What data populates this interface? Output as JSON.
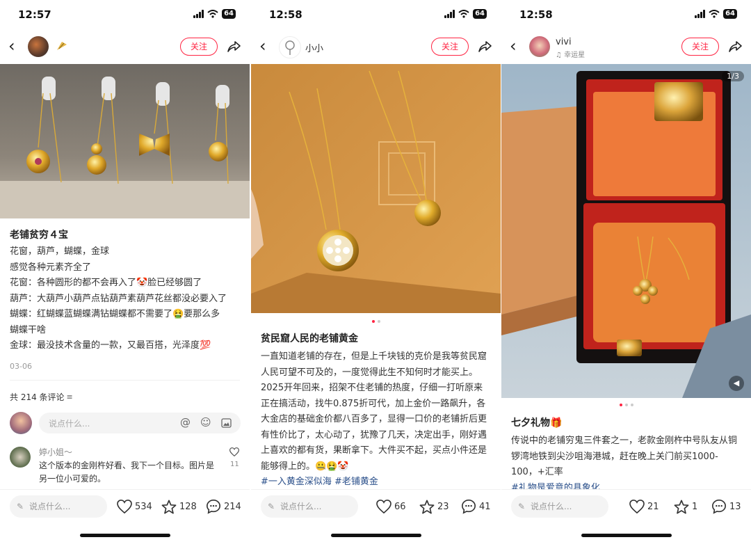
{
  "panels": [
    {
      "time": "12:57",
      "battery": "64",
      "follow": "关注",
      "title": "老铺贫穷４宝",
      "lines": [
        "花窗，葫芦，蝴蝶，金球",
        "感觉各种元素齐全了",
        "花窗：各种圆形的都不会再入了🤡脸已经够圆了",
        "葫芦：大葫芦小葫芦点钻葫芦素葫芦花丝都没必要入了",
        "蝴蝶：红蝴蝶蓝蝴蝶满钻蝴蝶都不需要了🤮要那么多",
        "蝴蝶干啥",
        "金球：最没技术含量的一款，又最百搭，光泽度💯"
      ],
      "date": "03-06",
      "comments_count": "共 214 条评论",
      "comment_placeholder": "说点什么...",
      "comment_user": "婷小姐～",
      "comment_text": "这个版本的金刚杵好看、我下一个目标。图片是另一位小可爱的。",
      "comment_likes": "11",
      "bar_placeholder": "说点什么...",
      "likes": "534",
      "stars": "128",
      "comments": "214"
    },
    {
      "time": "12:58",
      "battery": "64",
      "username": "小小",
      "follow": "关注",
      "title": "贫民窟人民的老铺黄金",
      "body": "一直知道老铺的存在，但是上千块钱的克价是我等贫民窟人民可望不可及的，一度觉得此生不知何时才能买上。2025开年回来，招架不住老铺的热度，仔细一打听原来正在搞活动，找牛0.875折可代，加上金价一路飙升，各大金店的基础金价都八百多了，显得一口价的老铺折后更有性价比了，太心动了，犹豫了几天，决定出手，刚好遇上喜欢的都有货，果断拿下。大件买不起，买点小件还是能够得上的。🤐🤮🤡",
      "tags": "#一入黄金深似海 #老铺黄金",
      "bar_placeholder": "说点什么...",
      "likes": "66",
      "stars": "23",
      "comments": "41"
    },
    {
      "time": "12:58",
      "battery": "64",
      "username": "vivi",
      "usersub": "♫ 幸运星",
      "follow": "关注",
      "page_count": "1/3",
      "title": "七夕礼物🎁",
      "body": "传说中的老铺穷鬼三件套之一，老款金刚杵中号队友从铜锣湾地铁到尖沙咀海港城，赶在晚上关门前买1000-100，+汇率",
      "tags": "#礼物是爱意的具象化",
      "bar_placeholder": "说点什么...",
      "likes": "21",
      "stars": "1",
      "comments": "13"
    }
  ],
  "colors": {
    "accent": "#ff2442",
    "tag": "#2a4f8a"
  }
}
